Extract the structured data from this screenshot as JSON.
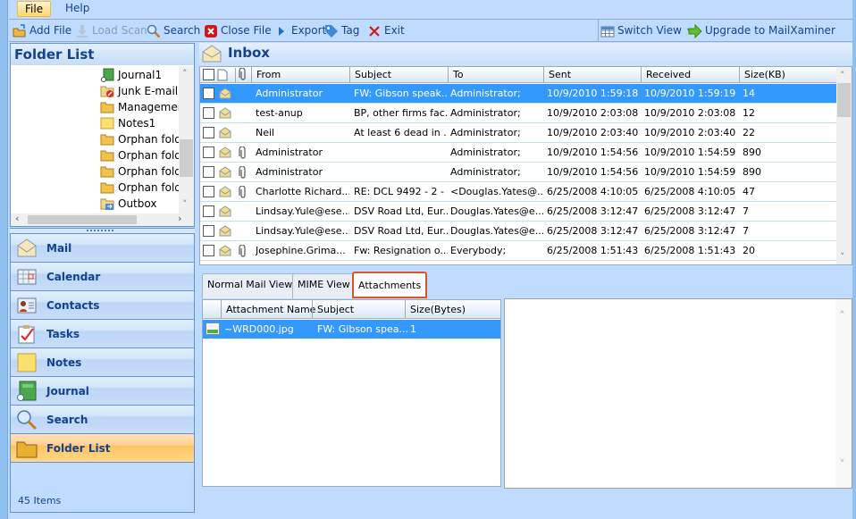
{
  "menu": {
    "items": [
      {
        "label": "File",
        "active": true
      },
      {
        "label": "Help",
        "active": false
      }
    ]
  },
  "toolbar": {
    "add_file": "Add File",
    "load_scan": "Load Scan",
    "search": "Search",
    "close_file": "Close File",
    "export": "Export",
    "tag": "Tag",
    "exit": "Exit",
    "switch_view": "Switch View",
    "upgrade": "Upgrade to MailXaminer"
  },
  "folder_pane": {
    "title": "Folder List",
    "items": [
      {
        "label": "Journal1",
        "icon": "journal-icon"
      },
      {
        "label": "Junk E-mail",
        "icon": "junk-folder-icon"
      },
      {
        "label": "Managemer",
        "icon": "folder-icon"
      },
      {
        "label": "Notes1",
        "icon": "notes-icon"
      },
      {
        "label": "Orphan fold",
        "icon": "folder-icon"
      },
      {
        "label": "Orphan fold",
        "icon": "folder-icon"
      },
      {
        "label": "Orphan fold",
        "icon": "folder-icon"
      },
      {
        "label": "Orphan fold",
        "icon": "folder-icon"
      },
      {
        "label": "Outbox",
        "icon": "outbox-icon"
      }
    ]
  },
  "nav": {
    "items": [
      {
        "label": "Mail",
        "icon": "mail-icon",
        "active": false
      },
      {
        "label": "Calendar",
        "icon": "calendar-icon",
        "active": false
      },
      {
        "label": "Contacts",
        "icon": "contacts-icon",
        "active": false
      },
      {
        "label": "Tasks",
        "icon": "tasks-icon",
        "active": false
      },
      {
        "label": "Notes",
        "icon": "notes-icon",
        "active": false
      },
      {
        "label": "Journal",
        "icon": "journal-icon",
        "active": false
      },
      {
        "label": "Search",
        "icon": "search-icon",
        "active": false
      },
      {
        "label": "Folder List",
        "icon": "folder-icon",
        "active": true
      }
    ]
  },
  "status": {
    "items_count": "45 Items"
  },
  "inbox": {
    "title": "Inbox",
    "columns": [
      "From",
      "Subject",
      "To",
      "Sent",
      "Received",
      "Size(KB)"
    ],
    "rows": [
      {
        "attachment": false,
        "from": "Administrator",
        "subject": "FW: Gibson speak...",
        "to": "Administrator;",
        "sent": "10/9/2010 1:59:18 ...",
        "received": "10/9/2010 1:59:19 ...",
        "size": "14",
        "selected": true
      },
      {
        "attachment": false,
        "from": "test-anup",
        "subject": "BP, other firms fac...",
        "to": "Administrator;",
        "sent": "10/9/2010 2:03:08 ...",
        "received": "10/9/2010 2:03:08 ...",
        "size": "12",
        "selected": false
      },
      {
        "attachment": false,
        "from": "Neil",
        "subject": "At least 6 dead in ...",
        "to": "Administrator;",
        "sent": "10/9/2010 2:03:40 ...",
        "received": "10/9/2010 2:03:40 ...",
        "size": "22",
        "selected": false
      },
      {
        "attachment": true,
        "from": "Administrator",
        "subject": "",
        "to": "Administrator;",
        "sent": "10/9/2010 1:54:56 ...",
        "received": "10/9/2010 1:54:59 ...",
        "size": "890",
        "selected": false
      },
      {
        "attachment": true,
        "from": "Administrator",
        "subject": "",
        "to": "Administrator;",
        "sent": "10/9/2010 1:54:56 ...",
        "received": "10/9/2010 1:54:59 ...",
        "size": "890",
        "selected": false
      },
      {
        "attachment": true,
        "from": "Charlotte Richard...",
        "subject": "RE: DCL 9492 - 2 - ...",
        "to": "<Douglas.Yates@...",
        "sent": "6/25/2008 4:10:05 ...",
        "received": "6/25/2008 4:10:05 ...",
        "size": "47",
        "selected": false
      },
      {
        "attachment": false,
        "from": "Lindsay.Yule@ese...",
        "subject": "DSV Road Ltd, Eur...",
        "to": "Douglas.Yates@e...",
        "sent": "6/25/2008 3:12:47 ...",
        "received": "6/25/2008 3:12:47 ...",
        "size": "7",
        "selected": false
      },
      {
        "attachment": false,
        "from": "Lindsay.Yule@ese...",
        "subject": "DSV Road Ltd, Eur...",
        "to": "Douglas.Yates@e...",
        "sent": "6/25/2008 3:12:47 ...",
        "received": "6/25/2008 3:12:47 ...",
        "size": "7",
        "selected": false
      },
      {
        "attachment": true,
        "from": "Josephine.Grima...",
        "subject": "Fw: Resignation o...",
        "to": "Everybody;",
        "sent": "6/25/2008 1:51:43 ...",
        "received": "6/25/2008 1:51:43 ...",
        "size": "20",
        "selected": false
      }
    ]
  },
  "tabs": {
    "items": [
      {
        "label": "Normal Mail View",
        "active": false
      },
      {
        "label": "MIME View",
        "active": false
      },
      {
        "label": "Attachments",
        "active": true
      }
    ]
  },
  "attachments": {
    "columns": [
      "Attachment Name",
      "Subject",
      "Size(Bytes)"
    ],
    "rows": [
      {
        "name": "~WRD000.jpg",
        "subject": "FW: Gibson spea...",
        "size": "1"
      }
    ]
  }
}
